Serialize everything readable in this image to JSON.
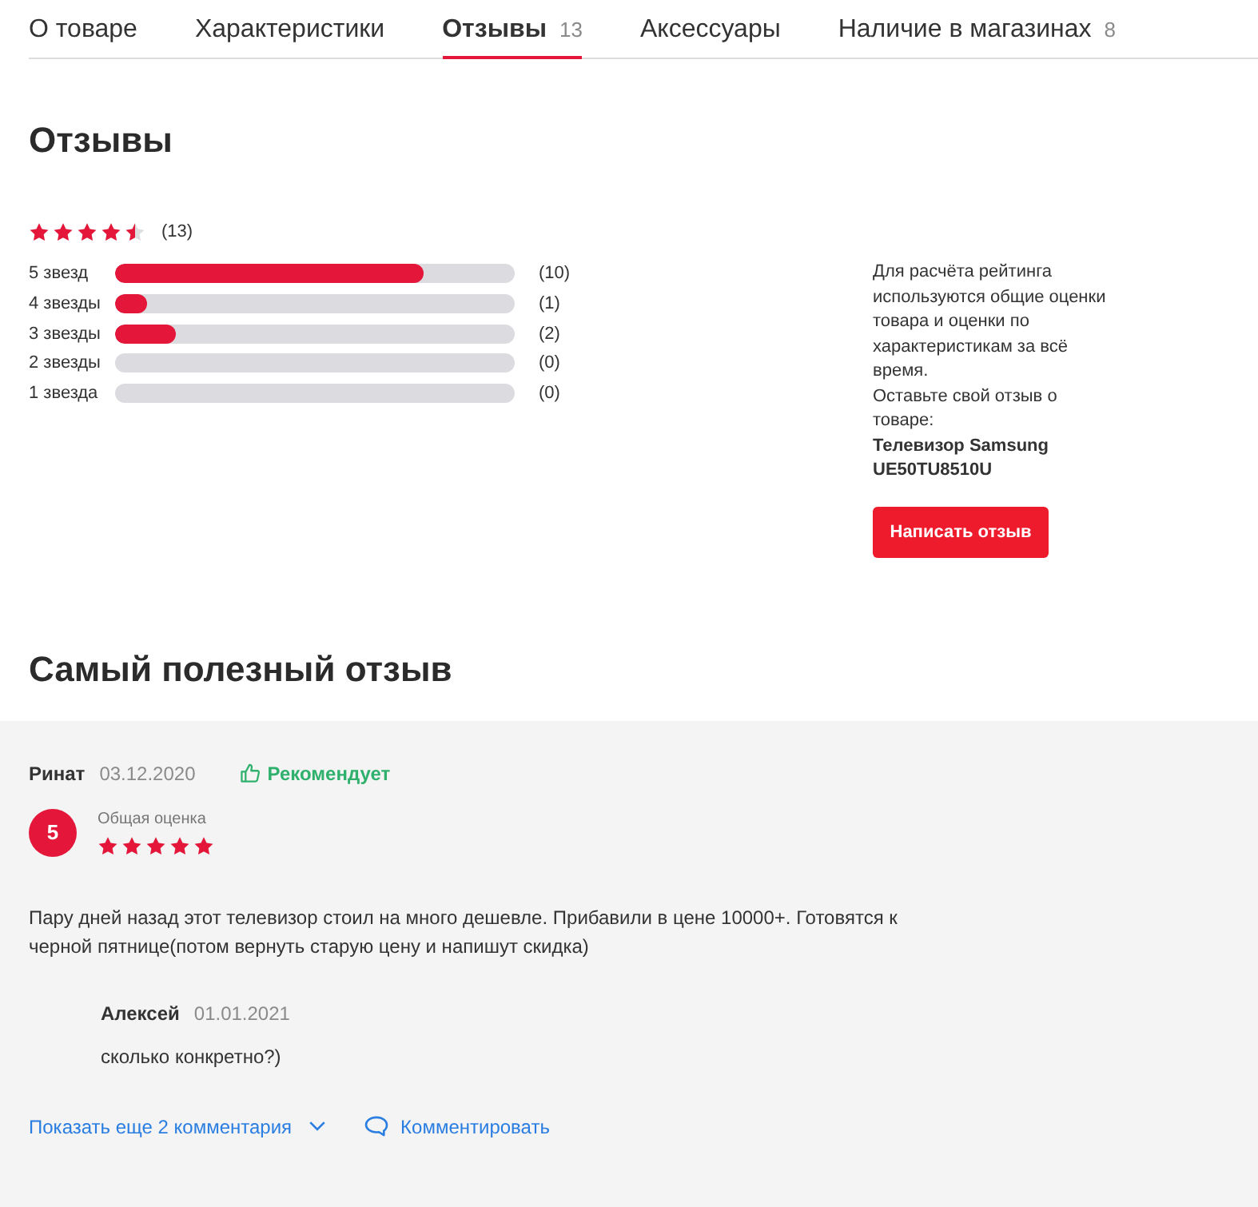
{
  "tabs": [
    {
      "label": "О товаре",
      "selected": false
    },
    {
      "label": "Характеристики",
      "selected": false
    },
    {
      "label": "Отзывы",
      "count": "13",
      "selected": true
    },
    {
      "label": "Аксессуары",
      "selected": false
    },
    {
      "label": "Наличие в магазинах",
      "count": "8",
      "selected": false
    }
  ],
  "reviews": {
    "title": "Отзывы",
    "rating": {
      "stars": 4.5,
      "count": "(13)"
    },
    "distribution": [
      {
        "label": "5 звезд",
        "level": 0.77,
        "count": "(10)"
      },
      {
        "label": "4 звезды",
        "level": 0.08,
        "count": "(1)"
      },
      {
        "label": "3 звезды",
        "level": 0.15,
        "count": "(2)"
      },
      {
        "label": "2 звезды",
        "count": "(0)"
      },
      {
        "label": "1 звезда",
        "count": "(0)"
      }
    ],
    "info": {
      "text": "Для расчёта рейтинга используются общие оценки товара и оценки по характеристикам за всё время.",
      "prompt": "Оставьте свой отзыв о товаре:",
      "product": "Телевизор Samsung UE50TU8510U"
    },
    "button": "Написать отзыв"
  },
  "best_review": {
    "title": "Самый полезный отзыв",
    "author": "Ринат",
    "date": "03.12.2020",
    "recommendation": "Рекомендует",
    "score": "5",
    "score_label": "Общая оценка",
    "stars": 5,
    "text": "Пару дней назад этот телевизор стоил на много дешевле. Прибавили в цене 10000+. Готовятся к черной пятнице(потом вернуть старую цену и напишут скидка)",
    "comments": [
      {
        "author": "Алексей",
        "date": "01.01.2021",
        "text": "сколько конкретно?)"
      }
    ],
    "more_comments": "Показать еще 2 комментария",
    "comment_action": "Комментировать"
  }
}
